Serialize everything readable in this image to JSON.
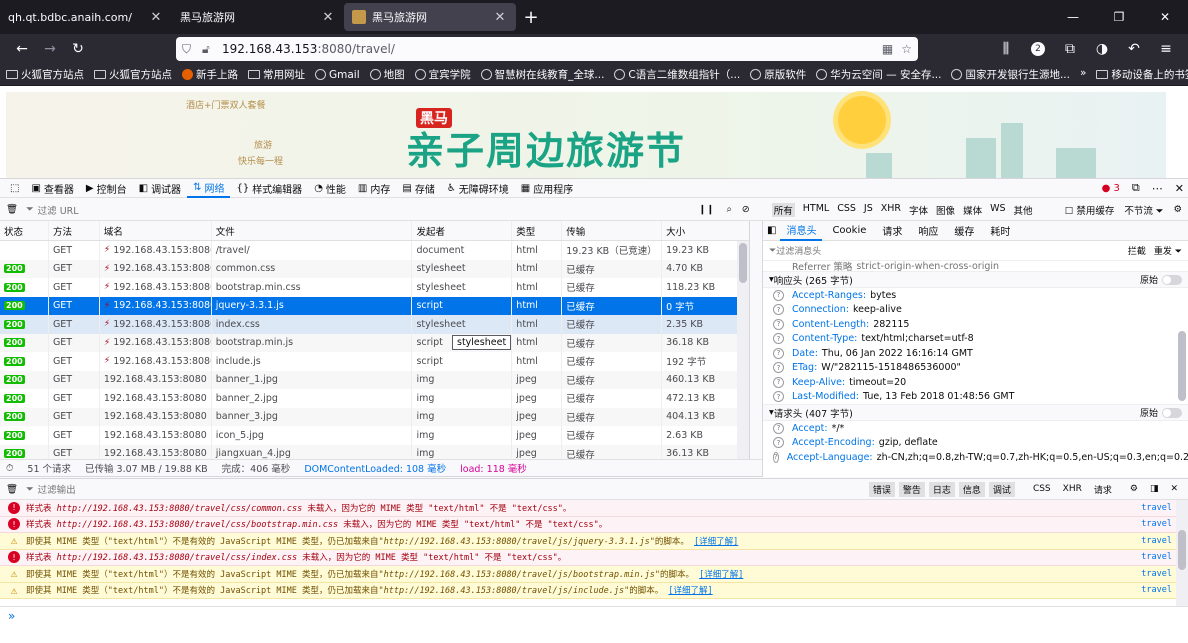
{
  "browser": {
    "tabs": [
      {
        "label": "qh.qt.bdbc.anaih.com/",
        "active": false
      },
      {
        "label": "黑马旅游网",
        "active": false
      },
      {
        "label": "黑马旅游网",
        "active": true
      }
    ],
    "url_host": "192.168.43.153",
    "url_path": ":8080/travel/",
    "badge_count": "2",
    "bookmarks": [
      "火狐官方站点",
      "火狐官方站点",
      "新手上路",
      "常用网址",
      "Gmail",
      "地图",
      "宜宾学院",
      "智慧树在线教育_全球...",
      "C语言二维数组指针（...",
      "原版软件",
      "华为云空间 — 安全存...",
      "国家开发银行生源地..."
    ],
    "mobile_bookmarks": "移动设备上的书签"
  },
  "banner": {
    "ad_line1": "酒店+门票双人套餐",
    "ad_line2": "旅游",
    "ad_line3": "快乐每一程",
    "logo": "黑马",
    "title": "亲子周边旅游节"
  },
  "devtools": {
    "tabs": [
      "查看器",
      "控制台",
      "调试器",
      "网络",
      "样式编辑器",
      "性能",
      "内存",
      "存储",
      "无障碍环境",
      "应用程序"
    ],
    "error_count": "3"
  },
  "network": {
    "filter_placeholder": "过滤 URL",
    "type_filters": [
      "所有",
      "HTML",
      "CSS",
      "JS",
      "XHR",
      "字体",
      "图像",
      "媒体",
      "WS",
      "其他"
    ],
    "disable_cache": "禁用缓存",
    "throttle": "不节流",
    "columns": [
      "状态",
      "方法",
      "域名",
      "文件",
      "发起者",
      "类型",
      "传输",
      "大小"
    ],
    "rows": [
      {
        "status": "",
        "method": "GET",
        "domain": "192.168.43.153:8080",
        "file": "/travel/",
        "initiator": "document",
        "type": "html",
        "transfer": "19.23 KB（已竞速）",
        "size": "19.23 KB",
        "state": "normal",
        "insecure": true
      },
      {
        "status": "200",
        "method": "GET",
        "domain": "192.168.43.153:8080",
        "file": "common.css",
        "initiator": "stylesheet",
        "type": "html",
        "transfer": "已缓存",
        "size": "4.70 KB",
        "state": "normal",
        "insecure": true
      },
      {
        "status": "200",
        "method": "GET",
        "domain": "192.168.43.153:8080",
        "file": "bootstrap.min.css",
        "initiator": "stylesheet",
        "type": "html",
        "transfer": "已缓存",
        "size": "118.23 KB",
        "state": "normal",
        "insecure": true
      },
      {
        "status": "200",
        "method": "GET",
        "domain": "192.168.43.153:8080",
        "file": "jquery-3.3.1.js",
        "initiator": "script",
        "type": "html",
        "transfer": "已缓存",
        "size": "0 字节",
        "state": "sel",
        "insecure": true
      },
      {
        "status": "200",
        "method": "GET",
        "domain": "192.168.43.153:8080",
        "file": "index.css",
        "initiator": "stylesheet",
        "type": "html",
        "transfer": "已缓存",
        "size": "2.35 KB",
        "state": "hover",
        "insecure": true
      },
      {
        "status": "200",
        "method": "GET",
        "domain": "192.168.43.153:8080",
        "file": "bootstrap.min.js",
        "initiator": "script",
        "type": "html",
        "transfer": "已缓存",
        "size": "36.18 KB",
        "state": "normal",
        "insecure": true
      },
      {
        "status": "200",
        "method": "GET",
        "domain": "192.168.43.153:8080",
        "file": "include.js",
        "initiator": "script",
        "type": "html",
        "transfer": "已缓存",
        "size": "192 字节",
        "state": "normal",
        "insecure": true
      },
      {
        "status": "200",
        "method": "GET",
        "domain": "192.168.43.153:8080",
        "file": "banner_1.jpg",
        "initiator": "img",
        "type": "jpeg",
        "transfer": "已缓存",
        "size": "460.13 KB",
        "state": "normal",
        "insecure": false
      },
      {
        "status": "200",
        "method": "GET",
        "domain": "192.168.43.153:8080",
        "file": "banner_2.jpg",
        "initiator": "img",
        "type": "jpeg",
        "transfer": "已缓存",
        "size": "472.13 KB",
        "state": "normal",
        "insecure": false
      },
      {
        "status": "200",
        "method": "GET",
        "domain": "192.168.43.153:8080",
        "file": "banner_3.jpg",
        "initiator": "img",
        "type": "jpeg",
        "transfer": "已缓存",
        "size": "404.13 KB",
        "state": "normal",
        "insecure": false
      },
      {
        "status": "200",
        "method": "GET",
        "domain": "192.168.43.153:8080",
        "file": "icon_5.jpg",
        "initiator": "img",
        "type": "jpeg",
        "transfer": "已缓存",
        "size": "2.63 KB",
        "state": "normal",
        "insecure": false
      },
      {
        "status": "200",
        "method": "GET",
        "domain": "192.168.43.153:8080",
        "file": "jiangxuan_4.jpg",
        "initiator": "img",
        "type": "jpeg",
        "transfer": "已缓存",
        "size": "36.13 KB",
        "state": "normal",
        "insecure": false
      }
    ],
    "tooltip": "stylesheet",
    "summary": {
      "requests": "51 个请求",
      "transferred": "已传输 3.07 MB / 19.88 KB",
      "finish": "完成：406 毫秒",
      "dcl": "DOMContentLoaded: 108 毫秒",
      "load": "load: 118 毫秒"
    }
  },
  "side": {
    "tabs": [
      "消息头",
      "Cookie",
      "请求",
      "响应",
      "缓存",
      "耗时"
    ],
    "filter_placeholder": "过滤消息头",
    "block": "拦截",
    "resend": "重发",
    "referrer": {
      "k": "Referrer 策略",
      "v": "strict-origin-when-cross-origin"
    },
    "response_title": "响应头 (265 字节)",
    "raw": "原始",
    "response_headers": [
      {
        "k": "Accept-Ranges:",
        "v": "bytes"
      },
      {
        "k": "Connection:",
        "v": "keep-alive"
      },
      {
        "k": "Content-Length:",
        "v": "282115"
      },
      {
        "k": "Content-Type:",
        "v": "text/html;charset=utf-8"
      },
      {
        "k": "Date:",
        "v": "Thu, 06 Jan 2022 16:16:14 GMT"
      },
      {
        "k": "ETag:",
        "v": "W/\"282115-1518486536000\""
      },
      {
        "k": "Keep-Alive:",
        "v": "timeout=20"
      },
      {
        "k": "Last-Modified:",
        "v": "Tue, 13 Feb 2018 01:48:56 GMT"
      }
    ],
    "request_title": "请求头 (407 字节)",
    "request_headers": [
      {
        "k": "Accept:",
        "v": "*/*"
      },
      {
        "k": "Accept-Encoding:",
        "v": "gzip, deflate"
      },
      {
        "k": "Accept-Language:",
        "v": "zh-CN,zh;q=0.8,zh-TW;q=0.7,zh-HK;q=0.5,en-US;q=0.3,en;q=0.2"
      }
    ]
  },
  "console": {
    "filter_placeholder": "过滤输出",
    "levels": [
      "错误",
      "警告",
      "日志",
      "信息",
      "调试"
    ],
    "extra_filters": [
      "CSS",
      "XHR",
      "请求"
    ],
    "logs": [
      {
        "level": "error",
        "pre": "样式表 ",
        "url": "http://192.168.43.153:8080/travel/css/common.css",
        "post": " 未载入，因为它的 MIME 类型 \"text/html\" 不是 \"text/css\"。",
        "link": "",
        "src": "travel"
      },
      {
        "level": "error",
        "pre": "样式表 ",
        "url": "http://192.168.43.153:8080/travel/css/bootstrap.min.css",
        "post": " 未载入，因为它的 MIME 类型 \"text/html\" 不是 \"text/css\"。",
        "link": "",
        "src": "travel"
      },
      {
        "level": "warn",
        "pre": "即使其 MIME 类型（\"text/html\"）不是有效的 JavaScript MIME 类型，仍已加载来自\"",
        "url": "http://192.168.43.153:8080/travel/js/jquery-3.3.1.js",
        "post": "\"的脚本。",
        "link": "[详细了解]",
        "src": "travel"
      },
      {
        "level": "error",
        "pre": "样式表 ",
        "url": "http://192.168.43.153:8080/travel/css/index.css",
        "post": " 未载入，因为它的 MIME 类型 \"text/html\" 不是 \"text/css\"。",
        "link": "",
        "src": "travel"
      },
      {
        "level": "warn",
        "pre": "即使其 MIME 类型（\"text/html\"）不是有效的 JavaScript MIME 类型，仍已加载来自\"",
        "url": "http://192.168.43.153:8080/travel/js/bootstrap.min.js",
        "post": "\"的脚本。",
        "link": "[详细了解]",
        "src": "travel"
      },
      {
        "level": "warn",
        "pre": "即使其 MIME 类型（\"text/html\"）不是有效的 JavaScript MIME 类型，仍已加载来自\"",
        "url": "http://192.168.43.153:8080/travel/js/include.js",
        "post": "\"的脚本。",
        "link": "[详细了解]",
        "src": "travel"
      }
    ],
    "prompt": "»"
  }
}
